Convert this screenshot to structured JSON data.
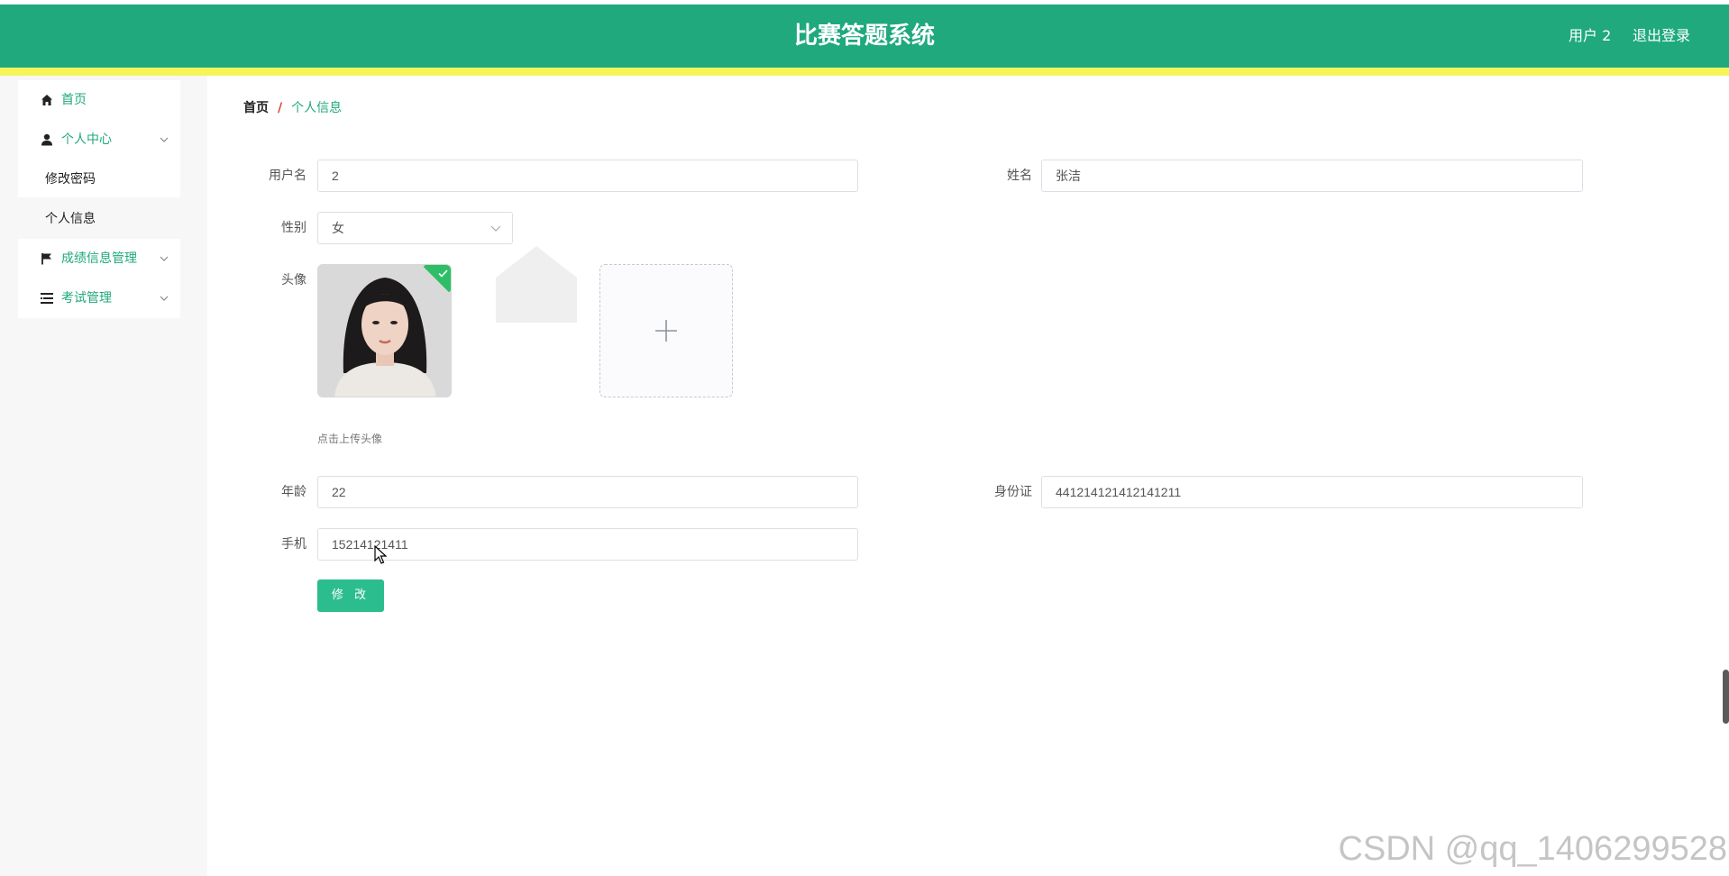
{
  "header": {
    "title": "比赛答题系统",
    "user": "用户 2",
    "logout": "退出登录"
  },
  "sidebar": {
    "home": "首页",
    "personal_center": "个人中心",
    "personal_sub": [
      "修改密码",
      "个人信息"
    ],
    "score_mgmt": "成绩信息管理",
    "exam_mgmt": "考试管理"
  },
  "breadcrumb": {
    "home": "首页",
    "separator": "/",
    "current": "个人信息"
  },
  "form": {
    "username_label": "用户名",
    "username_value": "2",
    "name_label": "姓名",
    "name_value": "张洁",
    "gender_label": "性别",
    "gender_value": "女",
    "avatar_label": "头像",
    "avatar_hint": "点击上传头像",
    "age_label": "年龄",
    "age_value": "22",
    "idcard_label": "身份证",
    "idcard_value": "441214121412141211",
    "phone_label": "手机",
    "phone_value": "15214121411",
    "submit": "修 改"
  },
  "watermark": "CSDN @qq_1406299528",
  "colors": {
    "header": "#1fa97d",
    "header_stripe": "#f6f45a",
    "accent": "#1fa97d",
    "button": "#2bbd8d",
    "breadcrumb_separator": "#d9432a"
  }
}
